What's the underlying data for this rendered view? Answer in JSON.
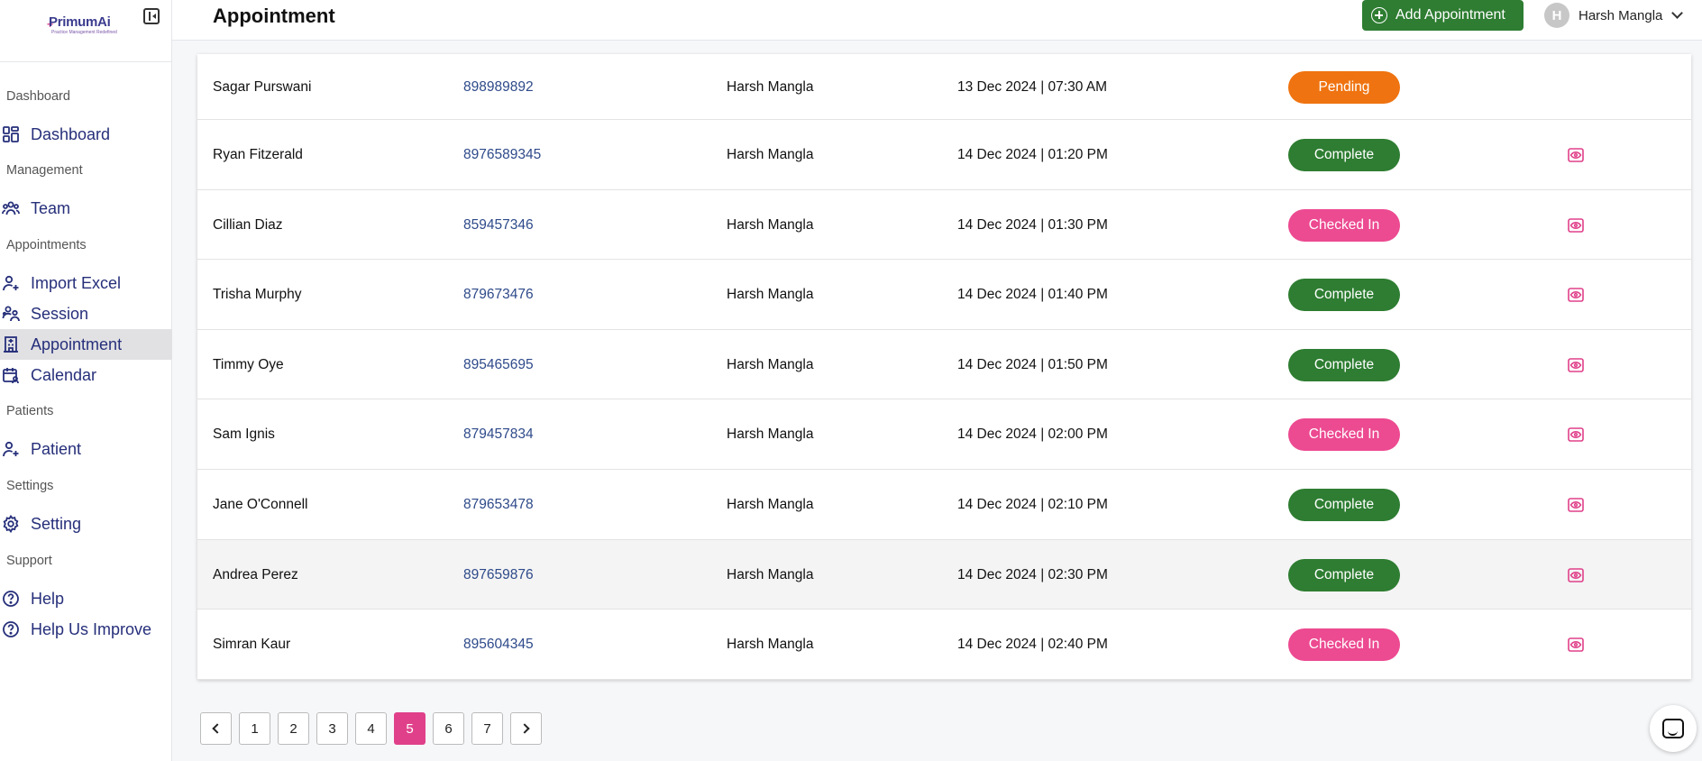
{
  "brand": {
    "name": "PrimumAi",
    "tagline": "Practice Management Redefined"
  },
  "sidebar": {
    "sections": [
      {
        "label": "Dashboard",
        "items": [
          {
            "label": "Dashboard",
            "icon": "dashboard-grid-icon"
          }
        ]
      },
      {
        "label": "Management",
        "items": [
          {
            "label": "Team",
            "icon": "team-icon"
          }
        ]
      },
      {
        "label": "Appointments",
        "items": [
          {
            "label": "Import Excel",
            "icon": "user-plus-icon"
          },
          {
            "label": "Session",
            "icon": "users-icon"
          },
          {
            "label": "Appointment",
            "icon": "building-icon",
            "active": true
          },
          {
            "label": "Calendar",
            "icon": "calendar-user-icon"
          }
        ]
      },
      {
        "label": "Patients",
        "items": [
          {
            "label": "Patient",
            "icon": "user-plus-icon"
          }
        ]
      },
      {
        "label": "Settings",
        "items": [
          {
            "label": "Setting",
            "icon": "gear-icon"
          }
        ]
      },
      {
        "label": "Support",
        "items": [
          {
            "label": "Help",
            "icon": "help-circle-icon"
          },
          {
            "label": "Help Us Improve",
            "icon": "help-circle-icon"
          }
        ]
      }
    ]
  },
  "header": {
    "title": "Appointment",
    "add_button": "Add Appointment",
    "user": {
      "initial": "H",
      "name": "Harsh Mangla"
    }
  },
  "colors": {
    "pending": "#ef7310",
    "complete": "#2e7d32",
    "checked_in": "#ec4a91",
    "accent": "#e0408a",
    "nav_text": "#262f7a"
  },
  "table": {
    "rows": [
      {
        "name": "Sagar Purswani",
        "phone": "898989892",
        "doctor": "Harsh Mangla",
        "datetime": "13 Dec 2024 | 07:30 AM",
        "status": "Pending",
        "status_key": "pending",
        "has_view": false
      },
      {
        "name": "Ryan Fitzerald",
        "phone": "8976589345",
        "doctor": "Harsh Mangla",
        "datetime": "14 Dec 2024 | 01:20 PM",
        "status": "Complete",
        "status_key": "complete",
        "has_view": true
      },
      {
        "name": "Cillian Diaz",
        "phone": "859457346",
        "doctor": "Harsh Mangla",
        "datetime": "14 Dec 2024 | 01:30 PM",
        "status": "Checked In",
        "status_key": "checked_in",
        "has_view": true
      },
      {
        "name": "Trisha Murphy",
        "phone": "879673476",
        "doctor": "Harsh Mangla",
        "datetime": "14 Dec 2024 | 01:40 PM",
        "status": "Complete",
        "status_key": "complete",
        "has_view": true
      },
      {
        "name": "Timmy Oye",
        "phone": "895465695",
        "doctor": "Harsh Mangla",
        "datetime": "14 Dec 2024 | 01:50 PM",
        "status": "Complete",
        "status_key": "complete",
        "has_view": true
      },
      {
        "name": "Sam Ignis",
        "phone": "879457834",
        "doctor": "Harsh Mangla",
        "datetime": "14 Dec 2024 | 02:00 PM",
        "status": "Checked In",
        "status_key": "checked_in",
        "has_view": true
      },
      {
        "name": "Jane O'Connell",
        "phone": "879653478",
        "doctor": "Harsh Mangla",
        "datetime": "14 Dec 2024 | 02:10 PM",
        "status": "Complete",
        "status_key": "complete",
        "has_view": true
      },
      {
        "name": "Andrea Perez",
        "phone": "897659876",
        "doctor": "Harsh Mangla",
        "datetime": "14 Dec 2024 | 02:30 PM",
        "status": "Complete",
        "status_key": "complete",
        "has_view": true,
        "hover": true
      },
      {
        "name": "Simran Kaur",
        "phone": "895604345",
        "doctor": "Harsh Mangla",
        "datetime": "14 Dec 2024 | 02:40 PM",
        "status": "Checked In",
        "status_key": "checked_in",
        "has_view": true
      }
    ]
  },
  "pagination": {
    "pages": [
      "1",
      "2",
      "3",
      "4",
      "5",
      "6",
      "7"
    ],
    "current": "5"
  }
}
